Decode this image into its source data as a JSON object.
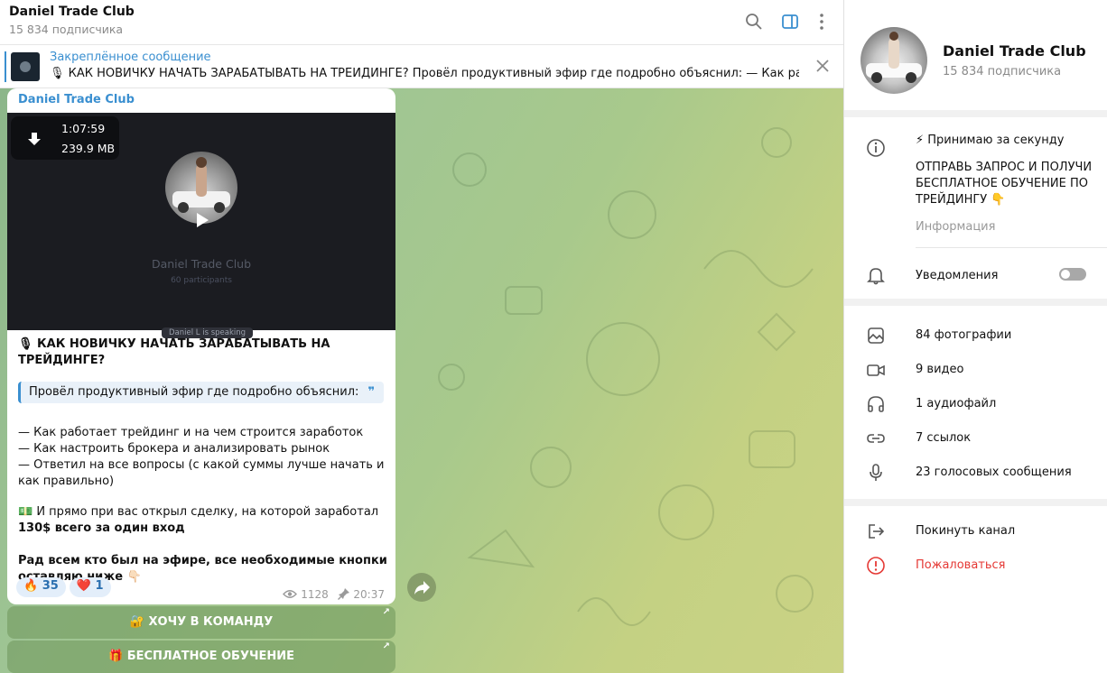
{
  "header": {
    "title": "Daniel Trade Club",
    "subscribers": "15 834 подписчика"
  },
  "pinned": {
    "label": "Закреплённое сообщение",
    "text": "🎙 КАК НОВИЧКУ НАЧАТЬ ЗАРАБАТЫВАТЬ НА ТРЕЙДИНГЕ?  Провёл продуктивный эфир где подробно объяснил:  — Как работае..."
  },
  "message": {
    "author": "Daniel Trade Club",
    "video": {
      "duration": "1:07:59",
      "size": "239.9 MB",
      "call_name": "Daniel Trade Club",
      "participants": "60 participants",
      "speaking": "Daniel L is speaking"
    },
    "title": "🎙 КАК НОВИЧКУ НАЧАТЬ ЗАРАБАТЫВАТЬ НА ТРЕЙДИНГЕ?",
    "quote": "Провёл продуктивный эфир где подробно объяснил:",
    "quote_mark": "❞",
    "lines": [
      "— Как работает трейдинг и на чем строится заработок",
      "— Как настроить брокера и анализировать рынок",
      "— Ответил на все вопросы (с какой суммы лучше начать и как правильно)"
    ],
    "deal_prefix": "💵 И прямо при вас открыл сделку, на которой заработал ",
    "deal_bold": "130$ всего за один вход",
    "closing": "Рад всем кто был на эфире, все необходимые кнопки оставляю ниже 👇🏻",
    "reactions": [
      {
        "emoji": "🔥",
        "count": "35"
      },
      {
        "emoji": "❤️",
        "count": "1"
      }
    ],
    "views": "1128",
    "time": "20:37",
    "buttons": [
      {
        "label": "🔐 ХОЧУ В КОМАНДУ"
      },
      {
        "label": "🎁 БЕСПЛАТНОЕ ОБУЧЕНИЕ"
      }
    ]
  },
  "profile": {
    "name": "Daniel Trade Club",
    "subscribers": "15 834 подписчика",
    "info_line1": "⚡ Принимаю за секунду",
    "info_line2": "ОТПРАВЬ ЗАПРОС И ПОЛУЧИ БЕСПЛАТНОЕ ОБУЧЕНИЕ ПО ТРЕЙДИНГУ 👇",
    "info_label": "Информация",
    "notifications": "Уведомления",
    "notifications_on": false,
    "media": {
      "photos": "84 фотографии",
      "videos": "9 видео",
      "audio": "1 аудиофайл",
      "links": "7 ссылок",
      "voice": "23 голосовых сообщения"
    },
    "leave": "Покинуть канал",
    "report": "Пожаловаться"
  },
  "colors": {
    "accent": "#3a8fd0",
    "danger": "#e53935"
  }
}
